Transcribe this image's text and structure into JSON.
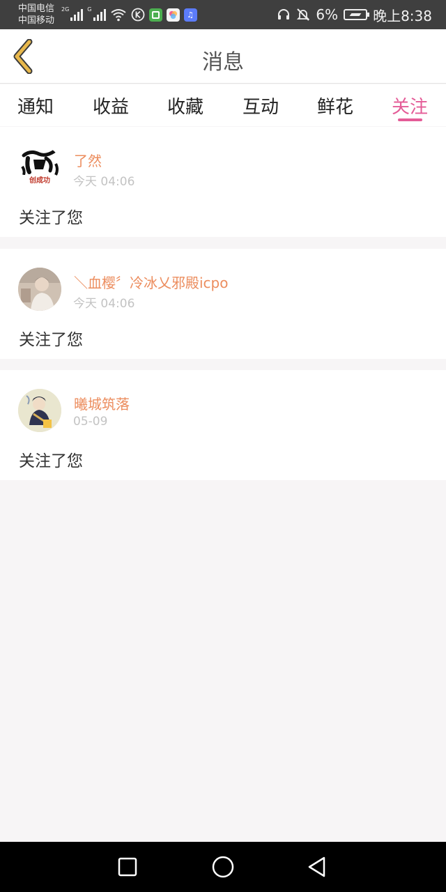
{
  "status_bar": {
    "carrier_1": "中国电信",
    "carrier_2": "中国移动",
    "net_1": "2G",
    "net_2": "G",
    "battery_percent": "6%",
    "time": "晚上8:38"
  },
  "header": {
    "title": "消息"
  },
  "tabs": [
    {
      "label": "通知",
      "active": false
    },
    {
      "label": "收益",
      "active": false
    },
    {
      "label": "收藏",
      "active": false
    },
    {
      "label": "互动",
      "active": false
    },
    {
      "label": "鲜花",
      "active": false
    },
    {
      "label": "关注",
      "active": true
    }
  ],
  "messages": [
    {
      "name": "了然",
      "time": "今天 04:06",
      "text": "关注了您",
      "avatar_text": "创成功"
    },
    {
      "name": "＼血樱〞冷冰乂邪殿icpo",
      "time": "今天 04:06",
      "text": "关注了您"
    },
    {
      "name": "曦城筑落",
      "time": "05-09",
      "text": "关注了您"
    }
  ],
  "colors": {
    "accent": "#e45c97",
    "name": "#ec8d5e",
    "time": "#c3c3c3",
    "background": "#f7f5f6",
    "back_arrow": "#e8b84c"
  },
  "icons": {
    "back": "chevron-left-icon",
    "nav_recent": "square-icon",
    "nav_home": "circle-icon",
    "nav_back": "triangle-back-icon"
  }
}
